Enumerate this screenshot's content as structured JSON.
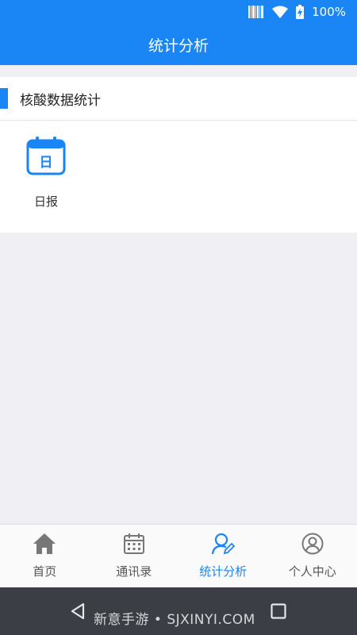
{
  "status_bar": {
    "battery_text": "100%",
    "icons": [
      "barcode-icon",
      "wifi-icon",
      "battery-icon"
    ]
  },
  "app_bar": {
    "title": "统计分析"
  },
  "section": {
    "title": "核酸数据统计",
    "items": [
      {
        "label": "日报",
        "icon_char": "日",
        "icon": "calendar-day-icon"
      }
    ]
  },
  "bottom_nav": {
    "items": [
      {
        "label": "首页",
        "icon": "home-icon"
      },
      {
        "label": "通讯录",
        "icon": "calendar-icon"
      },
      {
        "label": "统计分析",
        "icon": "user-edit-icon",
        "active": true
      },
      {
        "label": "个人中心",
        "icon": "profile-icon"
      }
    ]
  },
  "system_nav": {
    "watermark": "新意手游 • SJXINYI.COM"
  },
  "colors": {
    "primary": "#1a86f5",
    "background": "#efeff4",
    "system_nav": "#3b3e44"
  }
}
